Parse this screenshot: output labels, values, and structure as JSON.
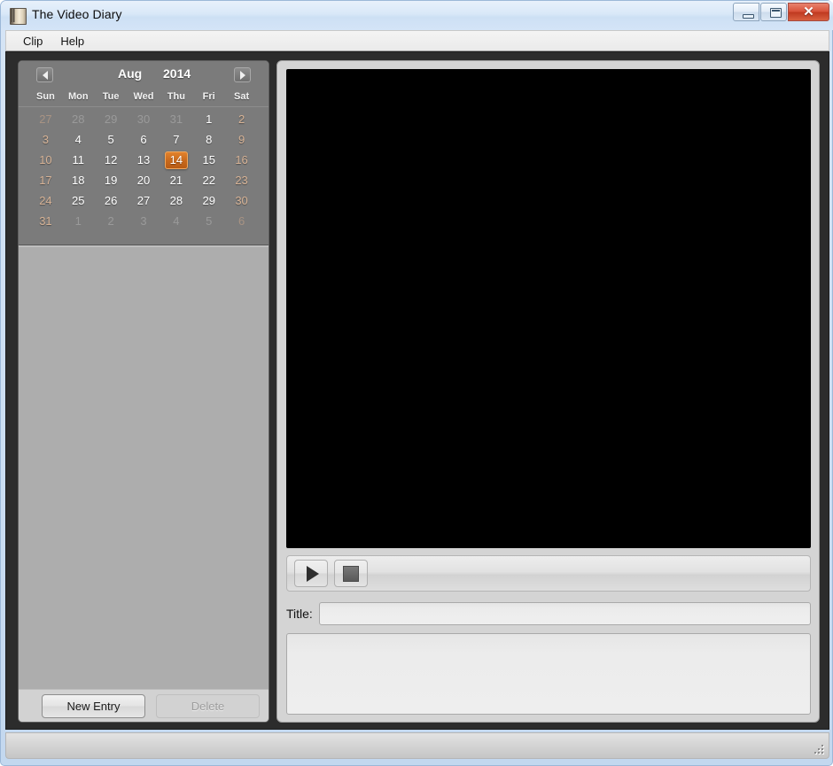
{
  "window": {
    "title": "The Video Diary",
    "icon": "diary-book-icon",
    "controls": {
      "minimize": "minimize-icon",
      "maximize": "maximize-icon",
      "close": "✕"
    }
  },
  "menubar": {
    "items": [
      {
        "label": "Clip"
      },
      {
        "label": "Help"
      }
    ]
  },
  "calendar": {
    "month": "Aug",
    "year": "2014",
    "prev_icon": "chevron-left-icon",
    "next_icon": "chevron-right-icon",
    "weekdays": [
      "Sun",
      "Mon",
      "Tue",
      "Wed",
      "Thu",
      "Fri",
      "Sat"
    ],
    "selected_day": 14,
    "accent_color": "#c96a1d",
    "weekend_color": "#d7b396",
    "weeks": [
      [
        {
          "d": "27",
          "other": true
        },
        {
          "d": "28",
          "other": true
        },
        {
          "d": "29",
          "other": true
        },
        {
          "d": "30",
          "other": true
        },
        {
          "d": "31",
          "other": true
        },
        {
          "d": "1",
          "other": false
        },
        {
          "d": "2",
          "other": false
        }
      ],
      [
        {
          "d": "3",
          "other": false
        },
        {
          "d": "4",
          "other": false
        },
        {
          "d": "5",
          "other": false
        },
        {
          "d": "6",
          "other": false
        },
        {
          "d": "7",
          "other": false
        },
        {
          "d": "8",
          "other": false
        },
        {
          "d": "9",
          "other": false
        }
      ],
      [
        {
          "d": "10",
          "other": false
        },
        {
          "d": "11",
          "other": false
        },
        {
          "d": "12",
          "other": false
        },
        {
          "d": "13",
          "other": false
        },
        {
          "d": "14",
          "other": false,
          "selected": true
        },
        {
          "d": "15",
          "other": false
        },
        {
          "d": "16",
          "other": false
        }
      ],
      [
        {
          "d": "17",
          "other": false
        },
        {
          "d": "18",
          "other": false
        },
        {
          "d": "19",
          "other": false
        },
        {
          "d": "20",
          "other": false
        },
        {
          "d": "21",
          "other": false
        },
        {
          "d": "22",
          "other": false
        },
        {
          "d": "23",
          "other": false
        }
      ],
      [
        {
          "d": "24",
          "other": false
        },
        {
          "d": "25",
          "other": false
        },
        {
          "d": "26",
          "other": false
        },
        {
          "d": "27",
          "other": false
        },
        {
          "d": "28",
          "other": false
        },
        {
          "d": "29",
          "other": false
        },
        {
          "d": "30",
          "other": false
        }
      ],
      [
        {
          "d": "31",
          "other": false
        },
        {
          "d": "1",
          "other": true
        },
        {
          "d": "2",
          "other": true
        },
        {
          "d": "3",
          "other": true
        },
        {
          "d": "4",
          "other": true
        },
        {
          "d": "5",
          "other": true
        },
        {
          "d": "6",
          "other": true
        }
      ]
    ]
  },
  "entry_list": {
    "items": []
  },
  "left_actions": {
    "new_entry_label": "New Entry",
    "delete_label": "Delete",
    "delete_disabled": true
  },
  "player": {
    "video_state": "blank",
    "play_icon": "play-icon",
    "stop_icon": "stop-icon"
  },
  "details": {
    "title_label": "Title:",
    "title_value": "",
    "title_placeholder": "",
    "notes_value": "",
    "notes_placeholder": ""
  },
  "statusbar": {
    "text": "",
    "grip_icon": "resize-grip-icon"
  }
}
